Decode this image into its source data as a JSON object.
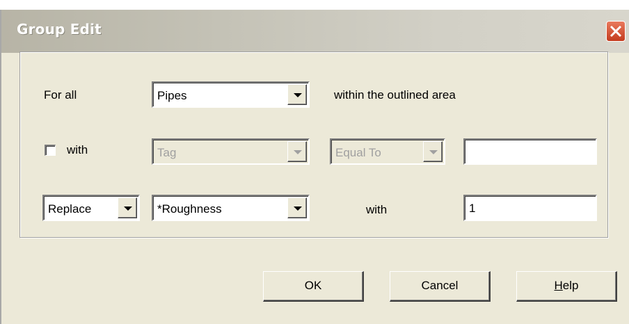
{
  "window": {
    "title": "Group Edit"
  },
  "row1": {
    "label": "For all",
    "object_type": "Pipes",
    "suffix": "within the outlined area"
  },
  "row2": {
    "checkbox_label": "with",
    "checked": false,
    "property": "Tag",
    "relation": "Equal To",
    "value": ""
  },
  "row3": {
    "action": "Replace",
    "property": "*Roughness",
    "with_label": "with",
    "value": "1"
  },
  "buttons": {
    "ok": "OK",
    "cancel": "Cancel",
    "help_first": "H",
    "help_rest": "elp"
  },
  "icons": {
    "close": "close-icon",
    "dropdown": "chevron-down-icon"
  },
  "colors": {
    "dialog_bg": "#ece9d8",
    "close_button": "#d8492a"
  }
}
